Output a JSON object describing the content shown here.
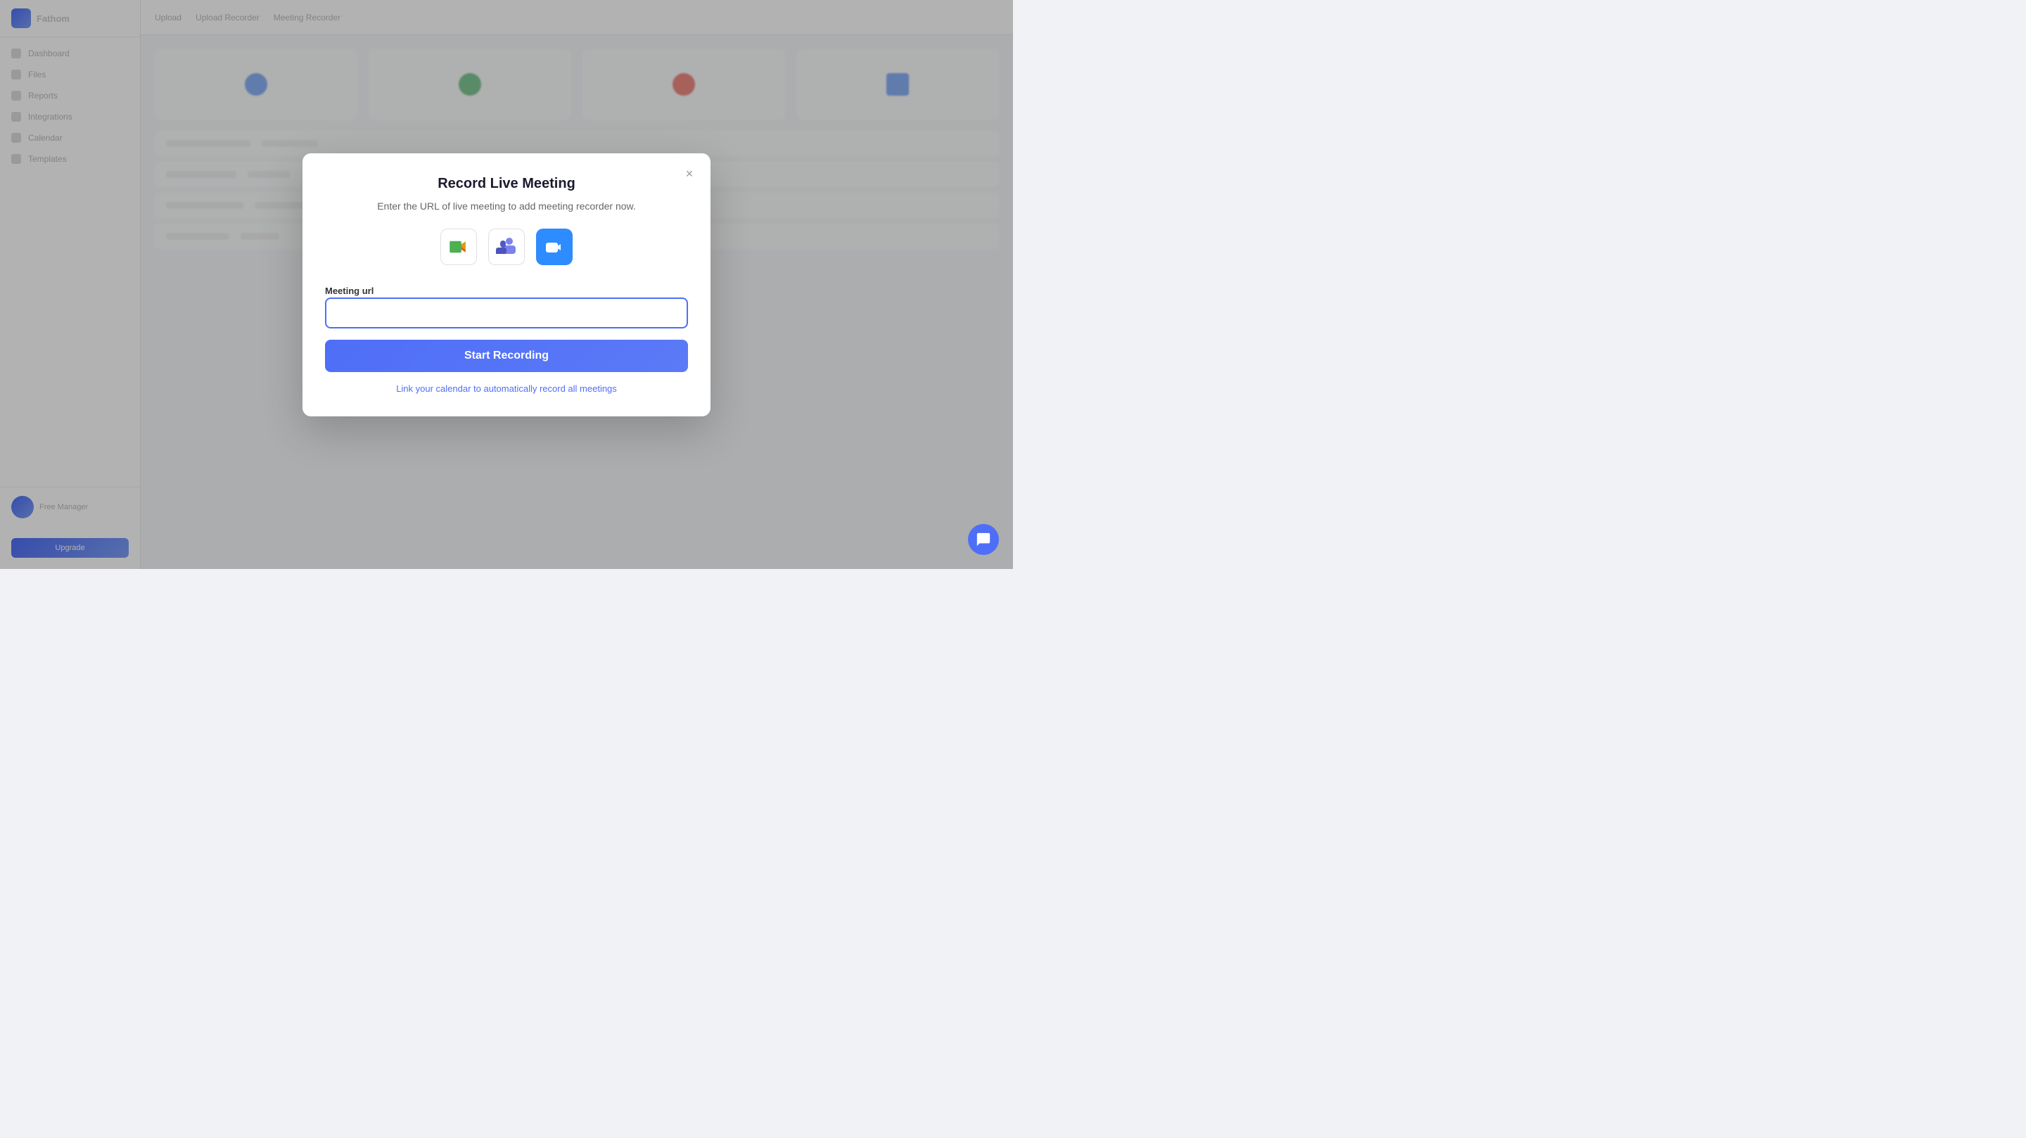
{
  "app": {
    "brand": "Fathom",
    "logo_bg": "#4f6ef7"
  },
  "sidebar": {
    "items": [
      {
        "label": "Dashboard",
        "icon": "grid-icon"
      },
      {
        "label": "Files",
        "icon": "folder-icon"
      },
      {
        "label": "Reports",
        "icon": "chart-icon"
      },
      {
        "label": "Integrations",
        "icon": "puzzle-icon"
      },
      {
        "label": "Calendar",
        "icon": "calendar-icon"
      },
      {
        "label": "Templates",
        "icon": "template-icon"
      }
    ],
    "user_name": "Free Manager",
    "upgrade_label": "Upgrade"
  },
  "topbar": {
    "items": [
      "Upload",
      "Upload Recorder",
      "Meeting Recorder"
    ]
  },
  "modal": {
    "title": "Record Live Meeting",
    "subtitle": "Enter the URL of live meeting to add meeting recorder now.",
    "icons": [
      {
        "name": "google-meet-icon",
        "label": "Google Meet"
      },
      {
        "name": "ms-teams-icon",
        "label": "Microsoft Teams"
      },
      {
        "name": "zoom-icon",
        "label": "Zoom"
      }
    ],
    "url_label": "Meeting url",
    "url_placeholder": "",
    "start_recording_label": "Start Recording",
    "calendar_link_label": "Link your calendar to automatically record all meetings",
    "close_label": "×"
  },
  "chat": {
    "icon": "chat-icon"
  }
}
